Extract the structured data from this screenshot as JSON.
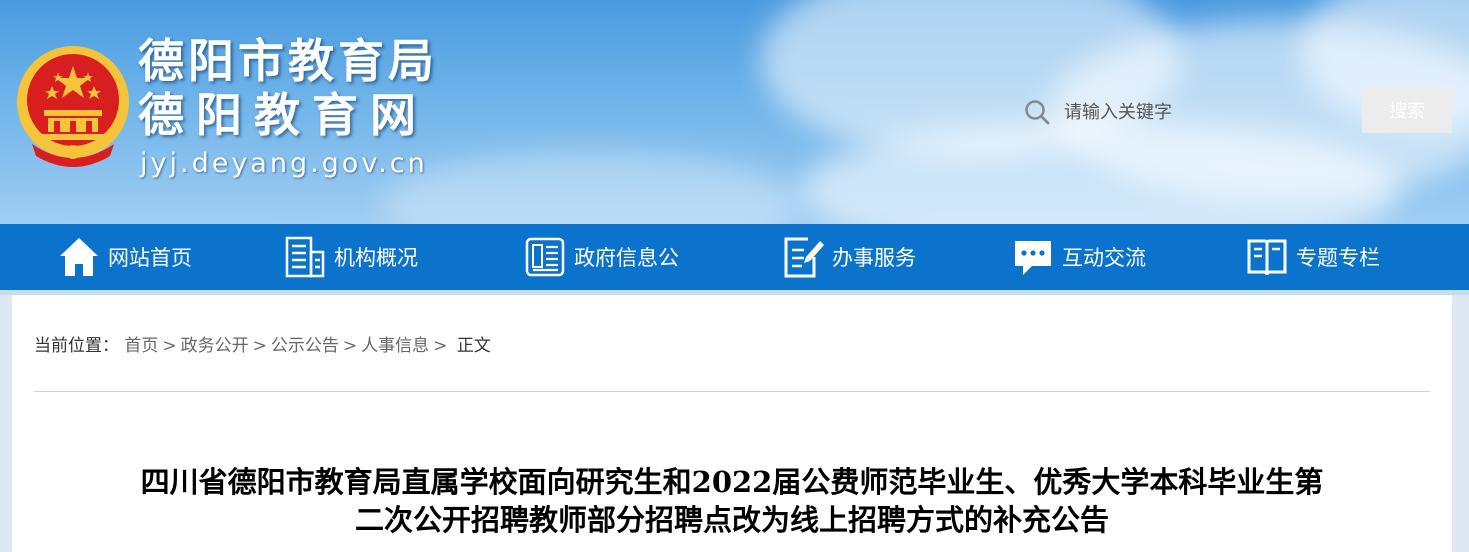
{
  "header": {
    "title_line1": "德阳市教育局",
    "title_line2": "德阳教育网",
    "domain": "jyj.deyang.gov.cn",
    "search_placeholder": "请输入关键字",
    "search_button": "搜索"
  },
  "nav": {
    "items": [
      {
        "label": "网站首页",
        "icon": "home-icon"
      },
      {
        "label": "机构概况",
        "icon": "building-icon"
      },
      {
        "label": "政府信息公",
        "icon": "newspaper-icon"
      },
      {
        "label": "办事服务",
        "icon": "document-edit-icon"
      },
      {
        "label": "互动交流",
        "icon": "chat-icon"
      },
      {
        "label": "专题专栏",
        "icon": "book-icon"
      }
    ]
  },
  "breadcrumb": {
    "prefix": "当前位置：",
    "items": [
      "首页",
      "政务公开",
      "公示公告",
      "人事信息"
    ],
    "current": "正文",
    "separator": ">"
  },
  "article": {
    "title_line1": "四川省德阳市教育局直属学校面向研究生和2022届公费师范毕业生、优秀大学本科毕业生第",
    "title_line2": "二次公开招聘教师部分招聘点改为线上招聘方式的补充公告"
  },
  "colors": {
    "nav_bg": "#0b73cc",
    "header_sky": "#6fb4ea",
    "emblem_red": "#d81e1e",
    "emblem_gold": "#f5c43a"
  }
}
